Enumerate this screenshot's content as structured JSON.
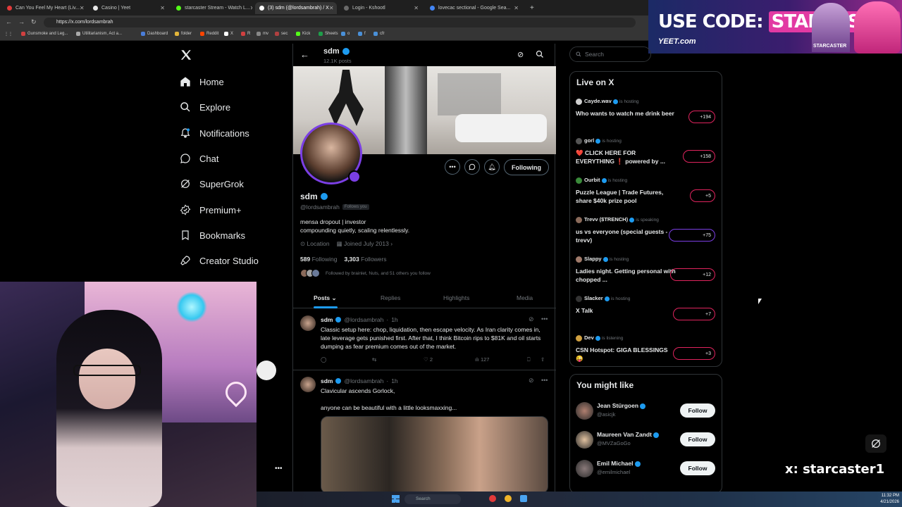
{
  "browser": {
    "tabs": [
      {
        "label": "Can You Feel My Heart (Liv...",
        "color": "#e23a3a"
      },
      {
        "label": "Casino | Yeet",
        "color": "#e7e7e7"
      },
      {
        "label": "starcaster Stream - Watch L...",
        "color": "#53fc18"
      },
      {
        "label": "(3) sdm (@lordsambrah) / X",
        "color": "#ffffff"
      },
      {
        "label": "Login - Kshootl",
        "color": "#4a4a4a"
      },
      {
        "label": "lovecac sectional - Google Sea...",
        "color": "#4285f4"
      }
    ],
    "url": "https://x.com/lordsambrah",
    "bookmarks": [
      "Gunsmoke and Leg...",
      "Utilitarianism, Act a...",
      "Dashboard",
      "folder",
      "Reddit",
      "X",
      "R",
      "mv",
      "sec",
      "Kick",
      "Sheets",
      "o",
      "f",
      "cfr"
    ]
  },
  "ad": {
    "code_prefix": "USE CODE:",
    "code": "STARCASTER",
    "brand": "YEET.com",
    "tag": "STARCASTER"
  },
  "nav": {
    "items": [
      "Home",
      "Explore",
      "Notifications",
      "Chat",
      "SuperGrok",
      "Premium+",
      "Bookmarks",
      "Creator Studio"
    ],
    "icons": [
      "home-icon",
      "search-icon",
      "bell-icon",
      "chat-icon",
      "grok-icon",
      "premium-icon",
      "bookmark-icon",
      "rocket-icon"
    ]
  },
  "header": {
    "name": "sdm",
    "posts": "12.1K posts"
  },
  "profile": {
    "name": "sdm",
    "handle": "@lordsambrah",
    "follows_you": "Follows you",
    "bio_line1": "mensa dropout | investor",
    "bio_line2": "compounding quietly, scaling relentlessly.",
    "location": "Location",
    "joined": "Joined July 2013",
    "following_count": "589",
    "following_label": "Following",
    "followers_count": "3,303",
    "followers_label": "Followers",
    "followed_by": "Followed by brainlet, Nuts, and 51 others you follow",
    "following_button": "Following"
  },
  "tabs": [
    "Posts",
    "Replies",
    "Highlights",
    "Media"
  ],
  "posts": [
    {
      "name": "sdm",
      "handle": "@lordsambrah",
      "time": "1h",
      "text": "Classic setup here: chop, liquidation, then escape velocity. As Iran clarity comes in, late leverage gets punished first. After that, I think Bitcoin rips to $81K and oil starts dumping as fear premium comes out of the market.",
      "likes": "2",
      "views": "127"
    },
    {
      "name": "sdm",
      "handle": "@lordsambrah",
      "time": "1h",
      "text1": "Clavicular ascends Gorlock,",
      "text2": "anyone can be beautiful with a little looksmaxxing..."
    }
  ],
  "search": {
    "placeholder": "Search"
  },
  "live": {
    "title": "Live on X",
    "items": [
      {
        "host": "Cayde.wav",
        "status": "is hosting",
        "title": "Who wants to watch me drink beer",
        "count": "+194"
      },
      {
        "host": "gorl",
        "status": "is hosting",
        "title": "❤️ CLICK HERE FOR EVERYTHING ❗ powered by ...",
        "count": "+158"
      },
      {
        "host": "Ourbit",
        "status": "is hosting",
        "title": "Puzzle League | Trade Futures, share $40k prize pool",
        "count": "+5"
      },
      {
        "host": "Trevv ($TRENCH)",
        "status": "is speaking",
        "title": "us vs everyone (special guests - trevv)",
        "count": "+75"
      },
      {
        "host": "Slappy",
        "status": "is hosting",
        "title": "Ladies night. Getting personal with chopped ...",
        "count": "+12"
      },
      {
        "host": "Slacker",
        "status": "is hosting",
        "title": "X Talk",
        "count": "+7"
      },
      {
        "host": "Dev",
        "status": "is listening",
        "title": "CSN Hotspot: GIGA BLESSINGS 😜",
        "count": "+3"
      }
    ]
  },
  "suggest": {
    "title": "You might like",
    "follow_label": "Follow",
    "items": [
      {
        "name": "Jean Stürgoen",
        "handle": "@asicjk"
      },
      {
        "name": "Maureen Van Zandt",
        "handle": "@MVZaGoGo"
      },
      {
        "name": "Emil Michael",
        "handle": "@emilmichael"
      }
    ]
  },
  "overlay": {
    "watermark": "x: starcaster1"
  },
  "taskbar": {
    "search": "Search",
    "time": "11:32 PM",
    "date": "4/21/2026"
  },
  "colors": {
    "accent": "#1d9bf0",
    "live_border": "#e0245e",
    "bg": "#000000"
  }
}
